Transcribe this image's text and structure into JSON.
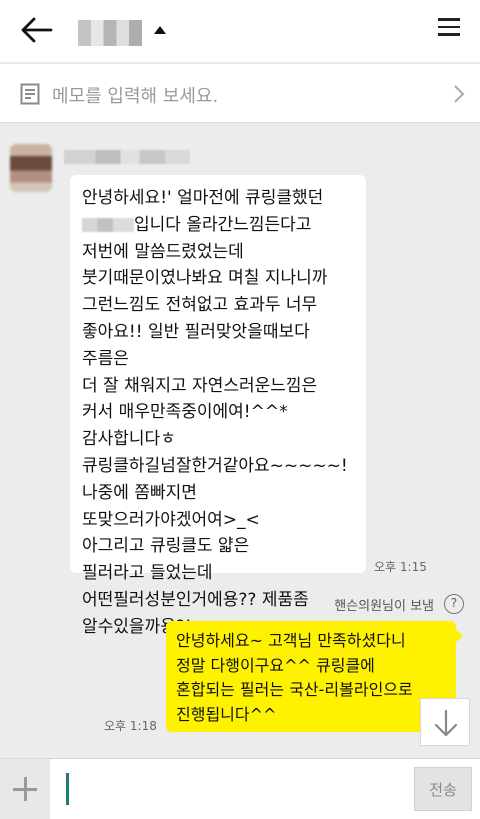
{
  "memo": {
    "placeholder": "메모를 입력해 보세요."
  },
  "incoming": {
    "lines": [
      "안녕하세요!' 얼마전에 큐링클했던",
      "입니다 올라간느낌든다고",
      "저번에 말씀드렸었는데",
      "붓기때문이였나봐요 며칠 지나니까",
      "그런느낌도 전혀없고 효과두 너무",
      "좋아요!! 일반 필러맞앗을때보다",
      "주름은",
      "더 잘 채워지고 자연스러운느낌은",
      "커서 매우만족중이에여!^^*",
      "감사합니다ㅎ",
      "큐링클하길넘잘한거같아요~~~~~!",
      "나중에 쫌빠지면",
      "또맞으러가야겠어여>_<",
      "아그리고 큐링클도 얇은",
      "필러라고 들었는데",
      "어떤필러성분인거에용?? 제품좀",
      "알수있을까용?!"
    ],
    "time": "오후 1:15"
  },
  "sent_by": "핸슨의원님이 보냄",
  "help_glyph": "?",
  "outgoing": {
    "lines": [
      "안녕하세요~ 고객님 만족하셨다니",
      "정말 다행이구요^^ 큐링클에",
      "혼합되는 필러는 국산-리볼라인으로",
      "진행됩니다^^"
    ],
    "time": "오후 1:18"
  },
  "composer": {
    "send_label": "전송"
  },
  "colors": {
    "outgoing_bubble": "#fff200",
    "incoming_bubble": "#ffffff",
    "background": "#ececec",
    "cursor": "#1f7a6f"
  }
}
